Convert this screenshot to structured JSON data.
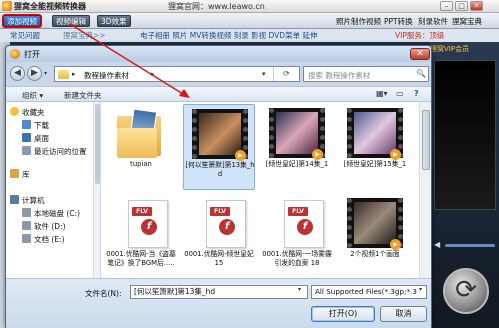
{
  "app": {
    "title": "狸窝全能视频转换器",
    "site": "狸窝官网：www.leawo.cn",
    "menu": {
      "add_video": "添加视频",
      "video_edit": "视频编辑",
      "effects": "3D效果",
      "links": [
        "照片制作视频",
        "PPT转换",
        "刻录软件",
        "狸窝宝典"
      ]
    },
    "subbar": {
      "faq": "常见问题",
      "breadcrumb": "狸窝宝典>>",
      "promo": "电子相册 照片 MV转换视频   刻录 影视 DVD菜单 延伸",
      "vip": "VIP服务：顶级",
      "vip_sub": "狸窝VIP会员"
    }
  },
  "dialog": {
    "title": "打开",
    "close_glyph": "✕",
    "address": {
      "path": "教程操作素材",
      "arrow": "▸"
    },
    "search_placeholder": "搜索 教程操作素材",
    "toolbar": {
      "organize": "组织 ▾",
      "new_folder": "新建文件夹"
    },
    "nav": [
      {
        "label": "收藏夹",
        "icon": "star-icon",
        "color": "#f2c230",
        "indent": 0
      },
      {
        "label": "下载",
        "icon": "download-folder-icon",
        "color": "#4a8ad0",
        "indent": 1
      },
      {
        "label": "桌面",
        "icon": "desktop-icon",
        "color": "#3a72b8",
        "indent": 1
      },
      {
        "label": "最近访问的位置",
        "icon": "recent-places-icon",
        "color": "#8a9ab0",
        "indent": 1
      },
      {
        "label": "库",
        "icon": "library-icon",
        "color": "#d9a640",
        "indent": 0
      },
      {
        "label": "计算机",
        "icon": "computer-icon",
        "color": "#5a7aa0",
        "indent": 0
      },
      {
        "label": "本地磁盘 (C:)",
        "icon": "drive-icon",
        "color": "#8a98a8",
        "indent": 1
      },
      {
        "label": "软件 (D:)",
        "icon": "drive-icon",
        "color": "#8a98a8",
        "indent": 1
      },
      {
        "label": "文档 (E:)",
        "icon": "drive-icon",
        "color": "#8a98a8",
        "indent": 1
      }
    ],
    "files": [
      {
        "name": "tupian",
        "kind": "folder",
        "selected": false
      },
      {
        "name": "[何以笙箫默]第13集_hd",
        "kind": "video",
        "selected": true
      },
      {
        "name": "[倾世皇妃]第14集_1",
        "kind": "video",
        "selected": false
      },
      {
        "name": "[倾世皇妃]第15集_1",
        "kind": "video",
        "selected": false
      },
      {
        "name": "0001.优酷网-当《盗墓笔记》换了BGM后.....",
        "kind": "flv",
        "selected": false
      },
      {
        "name": "0001.优酷网-倾世皇妃 15",
        "kind": "flv",
        "selected": false
      },
      {
        "name": "0001.优酷网-一场雾霾引发的血案 18",
        "kind": "flv",
        "selected": false
      },
      {
        "name": "2个视频1个画面",
        "kind": "video",
        "selected": false
      }
    ],
    "filename_label": "文件名(N):",
    "filename_value": "[何以笙箫默]第13集_hd",
    "filetype_value": "All Supported Files(*.3gp;*.3",
    "open_button": "打开(O)",
    "cancel_button": "取消",
    "nav_glyphs": {
      "back": "◀",
      "forward": "▶",
      "dropdown": "▾",
      "refresh": "⟳",
      "search": "🔍"
    }
  },
  "colors": {
    "annotation": "#e01010",
    "selection": "#cfe3f9"
  }
}
